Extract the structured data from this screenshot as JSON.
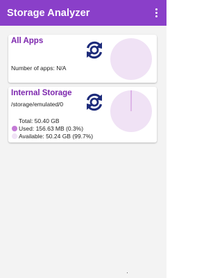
{
  "app_bar": {
    "title": "Storage Analyzer",
    "overflow_icon": "more-vert-icon",
    "background": "#8a3fc9"
  },
  "apps_card": {
    "title": "All Apps",
    "apps_count_text": "Number of apps: N/A",
    "refresh_icon": "refresh-icon"
  },
  "storage_card": {
    "title": "Internal Storage",
    "path": "/storage/emulated/0",
    "total": "Total: 50.40 GB",
    "used": "Used: 156.63 MB (0.3%)",
    "available": "Available: 50.24 GB (99.7%)",
    "used_fraction": 0.003,
    "refresh_icon": "refresh-icon"
  },
  "colors": {
    "accent": "#7c25ad",
    "used": "#c47ad6",
    "available": "#f0e2f5",
    "icon": "#1d2b7a"
  }
}
